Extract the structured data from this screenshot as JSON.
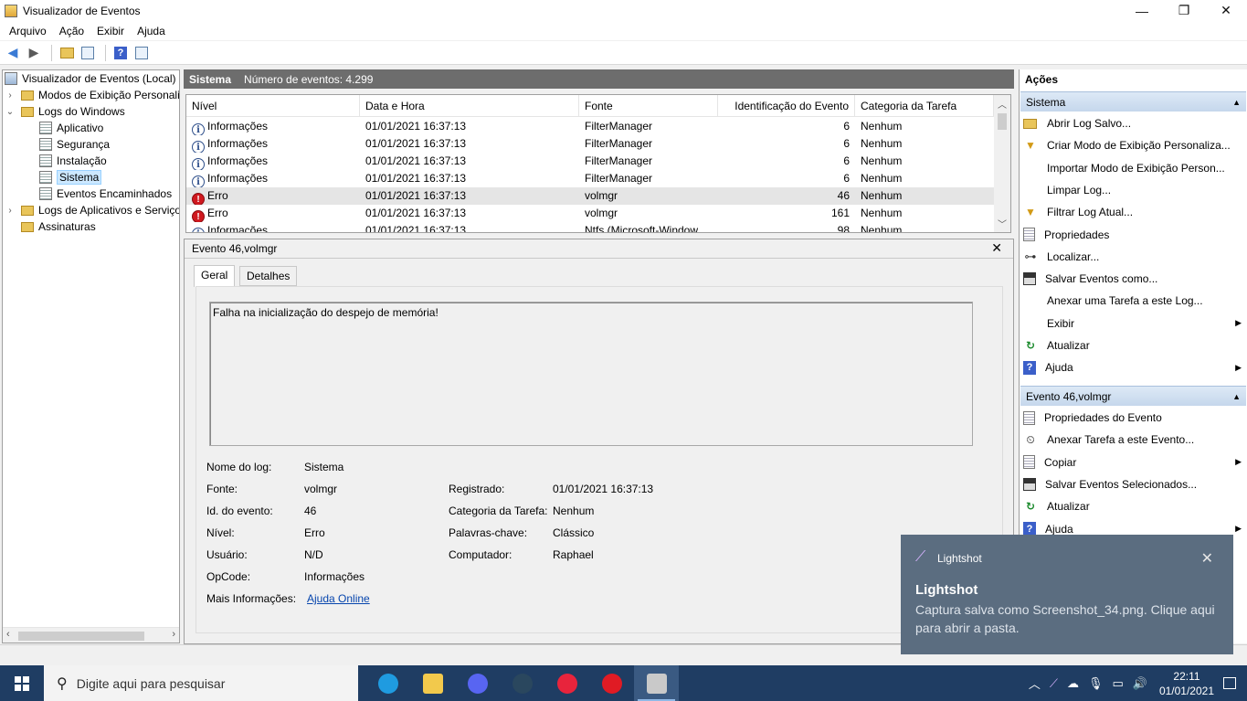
{
  "window": {
    "title": "Visualizador de Eventos",
    "controls": [
      "—",
      "❐",
      "✕"
    ]
  },
  "menu": [
    "Arquivo",
    "Ação",
    "Exibir",
    "Ajuda"
  ],
  "tree": [
    {
      "label": "Visualizador de Eventos (Local)",
      "icon": "event-viewer-icon"
    },
    {
      "label": "Modos de Exibição Personali",
      "icon": "folder-icon"
    },
    {
      "label": "Logs do Windows",
      "icon": "folder-icon"
    },
    {
      "label": "Aplicativo",
      "icon": "log-icon"
    },
    {
      "label": "Segurança",
      "icon": "log-icon"
    },
    {
      "label": "Instalação",
      "icon": "log-icon"
    },
    {
      "label": "Sistema",
      "icon": "log-icon",
      "selected": true
    },
    {
      "label": "Eventos Encaminhados",
      "icon": "log-icon"
    },
    {
      "label": "Logs de Aplicativos e Serviço",
      "icon": "folder-icon"
    },
    {
      "label": "Assinaturas",
      "icon": "folder-icon"
    }
  ],
  "center": {
    "name": "Sistema",
    "count": "Número de eventos: 4.299"
  },
  "grid": {
    "headers": [
      "Nível",
      "Data e Hora",
      "Fonte",
      "Identificação do Evento",
      "Categoria da Tarefa"
    ],
    "rows": [
      {
        "level": "Informações",
        "type": "info",
        "date": "01/01/2021 16:37:13",
        "source": "FilterManager",
        "id": "6",
        "category": "Nenhum"
      },
      {
        "level": "Informações",
        "type": "info",
        "date": "01/01/2021 16:37:13",
        "source": "FilterManager",
        "id": "6",
        "category": "Nenhum"
      },
      {
        "level": "Informações",
        "type": "info",
        "date": "01/01/2021 16:37:13",
        "source": "FilterManager",
        "id": "6",
        "category": "Nenhum"
      },
      {
        "level": "Informações",
        "type": "info",
        "date": "01/01/2021 16:37:13",
        "source": "FilterManager",
        "id": "6",
        "category": "Nenhum"
      },
      {
        "level": "Erro",
        "type": "error",
        "date": "01/01/2021 16:37:13",
        "source": "volmgr",
        "id": "46",
        "category": "Nenhum",
        "selected": true
      },
      {
        "level": "Erro",
        "type": "error",
        "date": "01/01/2021 16:37:13",
        "source": "volmgr",
        "id": "161",
        "category": "Nenhum"
      },
      {
        "level": "Informações",
        "type": "info",
        "date": "01/01/2021 16:37:13",
        "source": "Ntfs (Microsoft-Window",
        "id": "98",
        "category": "Nenhum"
      }
    ]
  },
  "detail": {
    "title": "Evento 46,volmgr",
    "tabs": [
      "Geral",
      "Detalhes"
    ],
    "message": "Falha na inicialização do despejo de memória!",
    "props_left": [
      {
        "label": "Nome do log:",
        "value": "Sistema"
      },
      {
        "label": "Fonte:",
        "value": "volmgr"
      },
      {
        "label": "Id. do evento:",
        "value": "46"
      },
      {
        "label": "Nível:",
        "value": "Erro"
      },
      {
        "label": "Usuário:",
        "value": "N/D"
      },
      {
        "label": "OpCode:",
        "value": "Informações"
      },
      {
        "label": "Mais Informações:",
        "value": "Ajuda Online"
      }
    ],
    "props_right": [
      {
        "label": "Registrado:",
        "value": "01/01/2021 16:37:13"
      },
      {
        "label": "Categoria da Tarefa:",
        "value": "Nenhum"
      },
      {
        "label": "Palavras-chave:",
        "value": "Clássico"
      },
      {
        "label": "Computador:",
        "value": "Raphael"
      }
    ]
  },
  "actions": {
    "title": "Ações",
    "section1": "Sistema",
    "items1": [
      {
        "label": "Abrir Log Salvo...",
        "icon": "folder-open-icon"
      },
      {
        "label": "Criar Modo de Exibição Personaliza...",
        "icon": "filter-icon"
      },
      {
        "label": "Importar Modo de Exibição Person...",
        "icon": ""
      },
      {
        "label": "Limpar Log...",
        "icon": ""
      },
      {
        "label": "Filtrar Log Atual...",
        "icon": "filter-icon"
      },
      {
        "label": "Propriedades",
        "icon": "properties-icon"
      },
      {
        "label": "Localizar...",
        "icon": "binoculars-icon"
      },
      {
        "label": "Salvar Eventos como...",
        "icon": "save-icon"
      },
      {
        "label": "Anexar uma Tarefa a este Log...",
        "icon": ""
      },
      {
        "label": "Exibir",
        "icon": "",
        "submenu": true
      },
      {
        "label": "Atualizar",
        "icon": "refresh-icon"
      },
      {
        "label": "Ajuda",
        "icon": "help-icon",
        "submenu": true
      }
    ],
    "section2": "Evento 46,volmgr",
    "items2": [
      {
        "label": "Propriedades do Evento",
        "icon": "properties-icon"
      },
      {
        "label": "Anexar Tarefa a este Evento...",
        "icon": "task-icon"
      },
      {
        "label": "Copiar",
        "icon": "copy-icon",
        "submenu": true
      },
      {
        "label": "Salvar Eventos Selecionados...",
        "icon": "save-icon"
      },
      {
        "label": "Atualizar",
        "icon": "refresh-icon"
      },
      {
        "label": "Ajuda",
        "icon": "help-icon",
        "submenu": true
      }
    ]
  },
  "toast": {
    "app": "Lightshot",
    "title": "Lightshot",
    "body": "Captura salva como Screenshot_34.png. Clique aqui para abrir a pasta."
  },
  "taskbar": {
    "search_placeholder": "Digite aqui para pesquisar",
    "apps": [
      {
        "name": "edge",
        "color": "#1f9be0"
      },
      {
        "name": "file-explorer",
        "color": "#f2c94c"
      },
      {
        "name": "discord",
        "color": "#5865f2"
      },
      {
        "name": "steam",
        "color": "#2a475e"
      },
      {
        "name": "media-player",
        "color": "#e8243c"
      },
      {
        "name": "opera",
        "color": "#e01b24"
      },
      {
        "name": "event-viewer",
        "color": "#c9c9c9",
        "active": true
      }
    ],
    "time": "22:11",
    "date": "01/01/2021"
  }
}
